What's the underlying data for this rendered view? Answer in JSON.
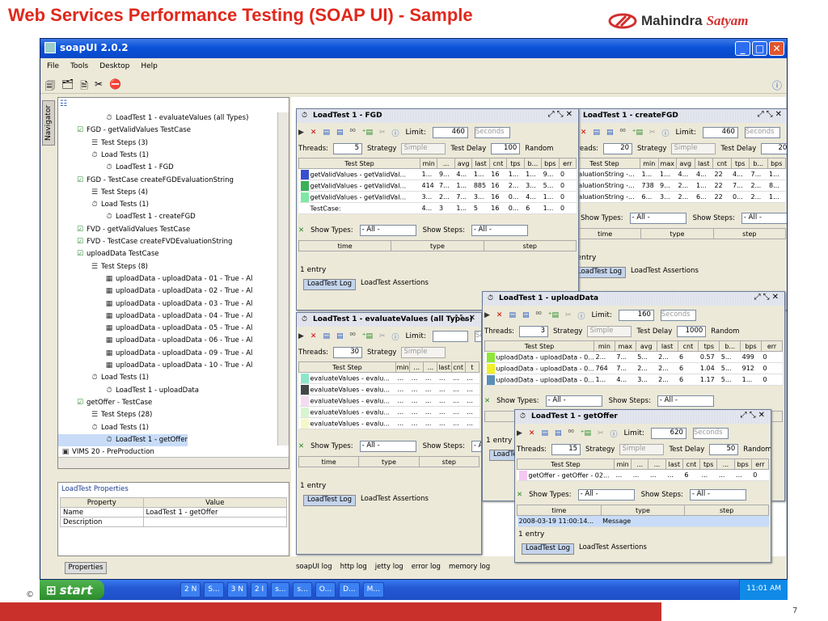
{
  "slide": {
    "title": "Web Services Performance Testing (SOAP UI) - Sample",
    "page_number": "7",
    "copyright_mark": "©"
  },
  "logo": {
    "brand_a": "Mahindra",
    "brand_b": "Satyam"
  },
  "app": {
    "title": "soapUI 2.0.2",
    "menu": [
      "File",
      "Tools",
      "Desktop",
      "Help"
    ],
    "navigator_label": "Navigator",
    "tree": [
      {
        "label": "LoadTest 1 - evaluateValues (all Types)",
        "icon": "timer-icon",
        "indent": 6
      },
      {
        "label": "FGD - getValidValues TestCase",
        "icon": "testcase-icon",
        "indent": 2
      },
      {
        "label": "Test Steps (3)",
        "icon": "steps-icon",
        "indent": 4
      },
      {
        "label": "Load Tests (1)",
        "icon": "timer-icon",
        "indent": 4
      },
      {
        "label": "LoadTest 1 - FGD",
        "icon": "timer-icon",
        "indent": 6
      },
      {
        "label": "FGD - TestCase createFGDEvaluationString",
        "icon": "testcase-icon",
        "indent": 2
      },
      {
        "label": "Test Steps (4)",
        "icon": "steps-icon",
        "indent": 4
      },
      {
        "label": "Load Tests (1)",
        "icon": "timer-icon",
        "indent": 4
      },
      {
        "label": "LoadTest 1 - createFGD",
        "icon": "timer-icon",
        "indent": 6
      },
      {
        "label": "FVD - getValidValues TestCase",
        "icon": "testcase-icon",
        "indent": 2
      },
      {
        "label": "FVD - TestCase createFVDEvaluationString",
        "icon": "testcase-icon",
        "indent": 2
      },
      {
        "label": "uploadData TestCase",
        "icon": "testcase-icon",
        "indent": 2
      },
      {
        "label": "Test Steps (8)",
        "icon": "steps-icon",
        "indent": 4
      },
      {
        "label": "uploadData - uploadData - 01 - True - Al",
        "icon": "soap-icon",
        "indent": 6
      },
      {
        "label": "uploadData - uploadData - 02 - True - Al",
        "icon": "soap-icon",
        "indent": 6
      },
      {
        "label": "uploadData - uploadData - 03 - True - Al",
        "icon": "soap-icon",
        "indent": 6
      },
      {
        "label": "uploadData - uploadData - 04 - True - Al",
        "icon": "soap-icon",
        "indent": 6
      },
      {
        "label": "uploadData - uploadData - 05 - True - Al",
        "icon": "soap-icon",
        "indent": 6
      },
      {
        "label": "uploadData - uploadData - 06 - True - Al",
        "icon": "soap-icon",
        "indent": 6
      },
      {
        "label": "uploadData - uploadData - 09 - True - Al",
        "icon": "soap-icon",
        "indent": 6
      },
      {
        "label": "uploadData - uploadData - 10 - True - Al",
        "icon": "soap-icon",
        "indent": 6
      },
      {
        "label": "Load Tests (1)",
        "icon": "timer-icon",
        "indent": 4
      },
      {
        "label": "LoadTest 1 - uploadData",
        "icon": "timer-icon",
        "indent": 6
      },
      {
        "label": "getOffer - TestCase",
        "icon": "testcase-icon",
        "indent": 2
      },
      {
        "label": "Test Steps (28)",
        "icon": "steps-icon",
        "indent": 4
      },
      {
        "label": "Load Tests (1)",
        "icon": "timer-icon",
        "indent": 4
      },
      {
        "label": "LoadTest 1 - getOffer",
        "icon": "timer-icon",
        "indent": 6,
        "selected": true
      },
      {
        "label": "VIMS 20 - PreProduction",
        "icon": "project-icon",
        "indent": 0
      }
    ],
    "props": {
      "title": "LoadTest Properties",
      "col_property": "Property",
      "col_value": "Value",
      "rows": [
        {
          "k": "Name",
          "v": "LoadTest 1 - getOffer"
        },
        {
          "k": "Description",
          "v": ""
        }
      ],
      "tab": "Properties"
    },
    "bottom_tabs": [
      "soapUI log",
      "http log",
      "jetty log",
      "error log",
      "memory log"
    ],
    "common": {
      "limit": "Limit:",
      "threads": "Threads:",
      "strategy": "Strategy",
      "strategy_val": "Simple",
      "test_delay": "Test Delay",
      "random": "Random",
      "seconds": "Seconds",
      "show_types": "Show Types:",
      "show_steps": "Show Steps:",
      "all": "- All -",
      "col_time": "time",
      "col_type": "type",
      "col_step": "step",
      "one_entry": "1 entry",
      "tab_log": "LoadTest Log",
      "tab_assert": "LoadTest Assertions",
      "col_teststep": "Test Step"
    },
    "windows": {
      "fgd": {
        "title": "LoadTest 1 - FGD",
        "limit": "460",
        "threads": "5",
        "delay": "100",
        "headers": [
          "Test Step",
          "min",
          "...",
          "avg",
          "last",
          "cnt",
          "tps",
          "b...",
          "bps",
          "err"
        ],
        "rows": [
          {
            "color": "#3a4fd0",
            "cells": [
              "getValidValues - getValidVal...",
              "1...",
              "9...",
              "4...",
              "1...",
              "16",
              "1...",
              "1...",
              "9...",
              "0"
            ]
          },
          {
            "color": "#3ab05a",
            "cells": [
              "getValidValues - getValidVal...",
              "414",
              "7...",
              "1...",
              "885",
              "16",
              "2...",
              "3...",
              "5...",
              "0"
            ]
          },
          {
            "color": "#7ee8a8",
            "cells": [
              "getValidValues - getValidVal...",
              "3...",
              "2...",
              "7...",
              "3...",
              "16",
              "0...",
              "4...",
              "1...",
              "0"
            ]
          },
          {
            "color": "#ffffff",
            "cells": [
              "TestCase:",
              "4...",
              "3",
              "1...",
              "5",
              "16",
              "0...",
              "6",
              "1...",
              "0"
            ]
          }
        ]
      },
      "createfgd": {
        "title": "LoadTest 1 - createFGD",
        "limit": "460",
        "threads": "20",
        "delay": "20",
        "headers": [
          "Test Step",
          "min",
          "max",
          "avg",
          "last",
          "cnt",
          "tps",
          "b...",
          "bps"
        ],
        "rows": [
          {
            "cells": [
              "EvaluationString -...",
              "1...",
              "1...",
              "4...",
              "4...",
              "22",
              "4...",
              "7...",
              "1..."
            ]
          },
          {
            "cells": [
              "EvaluationString -...",
              "738",
              "9...",
              "2...",
              "1...",
              "22",
              "7...",
              "2...",
              "8..."
            ]
          },
          {
            "cells": [
              "EvaluationString -...",
              "6...",
              "3...",
              "2...",
              "6...",
              "22",
              "0...",
              "2...",
              "1..."
            ]
          }
        ]
      },
      "evaluate": {
        "title": "LoadTest 1 - evaluateValues (all Types)",
        "limit": "",
        "threads": "30",
        "headers": [
          "Test Step",
          "min",
          "...",
          "...",
          "last",
          "cnt",
          "t"
        ],
        "rows": [
          {
            "color": "#8ee6c8",
            "cells": [
              "evaluateValues - evalu...",
              "...",
              "...",
              "...",
              "...",
              "...",
              "..."
            ]
          },
          {
            "color": "#404848",
            "cells": [
              "evaluateValues - evalu...",
              "...",
              "...",
              "...",
              "...",
              "...",
              "..."
            ]
          },
          {
            "color": "#f4dcf0",
            "cells": [
              "evaluateValues - evalu...",
              "...",
              "...",
              "...",
              "...",
              "...",
              "..."
            ]
          },
          {
            "color": "#d8f4d0",
            "cells": [
              "evaluateValues - evalu...",
              "...",
              "...",
              "...",
              "...",
              "...",
              "..."
            ]
          },
          {
            "color": "#f4f8c8",
            "cells": [
              "evaluateValues - evalu...",
              "...",
              "...",
              "...",
              "...",
              "...",
              "..."
            ]
          }
        ]
      },
      "upload": {
        "title": "LoadTest 1 - uploadData",
        "limit": "160",
        "threads": "3",
        "delay": "1000",
        "headers": [
          "Test Step",
          "min",
          "max",
          "avg",
          "last",
          "cnt",
          "tps",
          "b...",
          "bps",
          "err"
        ],
        "rows": [
          {
            "color": "#8ee838",
            "cells": [
              "uploadData - uploadData - 0...",
              "2...",
              "7...",
              "5...",
              "2...",
              "6",
              "0.57",
              "5...",
              "499",
              "0"
            ]
          },
          {
            "color": "#f0f028",
            "cells": [
              "uploadData - uploadData - 0...",
              "764",
              "7...",
              "2...",
              "2...",
              "6",
              "1.04",
              "5...",
              "912",
              "0"
            ]
          },
          {
            "color": "#5a90b8",
            "cells": [
              "uploadData - uploadData - 0...",
              "1...",
              "4...",
              "3...",
              "2...",
              "6",
              "1.17",
              "5...",
              "1...",
              "0"
            ]
          }
        ]
      },
      "getoffer": {
        "title": "LoadTest 1 - getOffer",
        "limit": "620",
        "threads": "15",
        "delay": "50",
        "headers": [
          "Test Step",
          "min",
          "...",
          "...",
          "last",
          "cnt",
          "tps",
          "...",
          "bps",
          "err"
        ],
        "rows": [
          {
            "color": "#f4c8f0",
            "cells": [
              "getOffer - getOffer - 02...",
              "...",
              "...",
              "...",
              "...",
              "6",
              "...",
              "...",
              "...",
              "0"
            ]
          }
        ],
        "log_row": {
          "time": "2008-03-19 11:00:14...",
          "type": "Message"
        }
      }
    }
  },
  "taskbar": {
    "start": "start",
    "items": [
      "2 N",
      "S...",
      "3 N",
      "2 I",
      "s...",
      "s...",
      "O...",
      "D...",
      "M..."
    ],
    "clock": "11:01 AM"
  }
}
